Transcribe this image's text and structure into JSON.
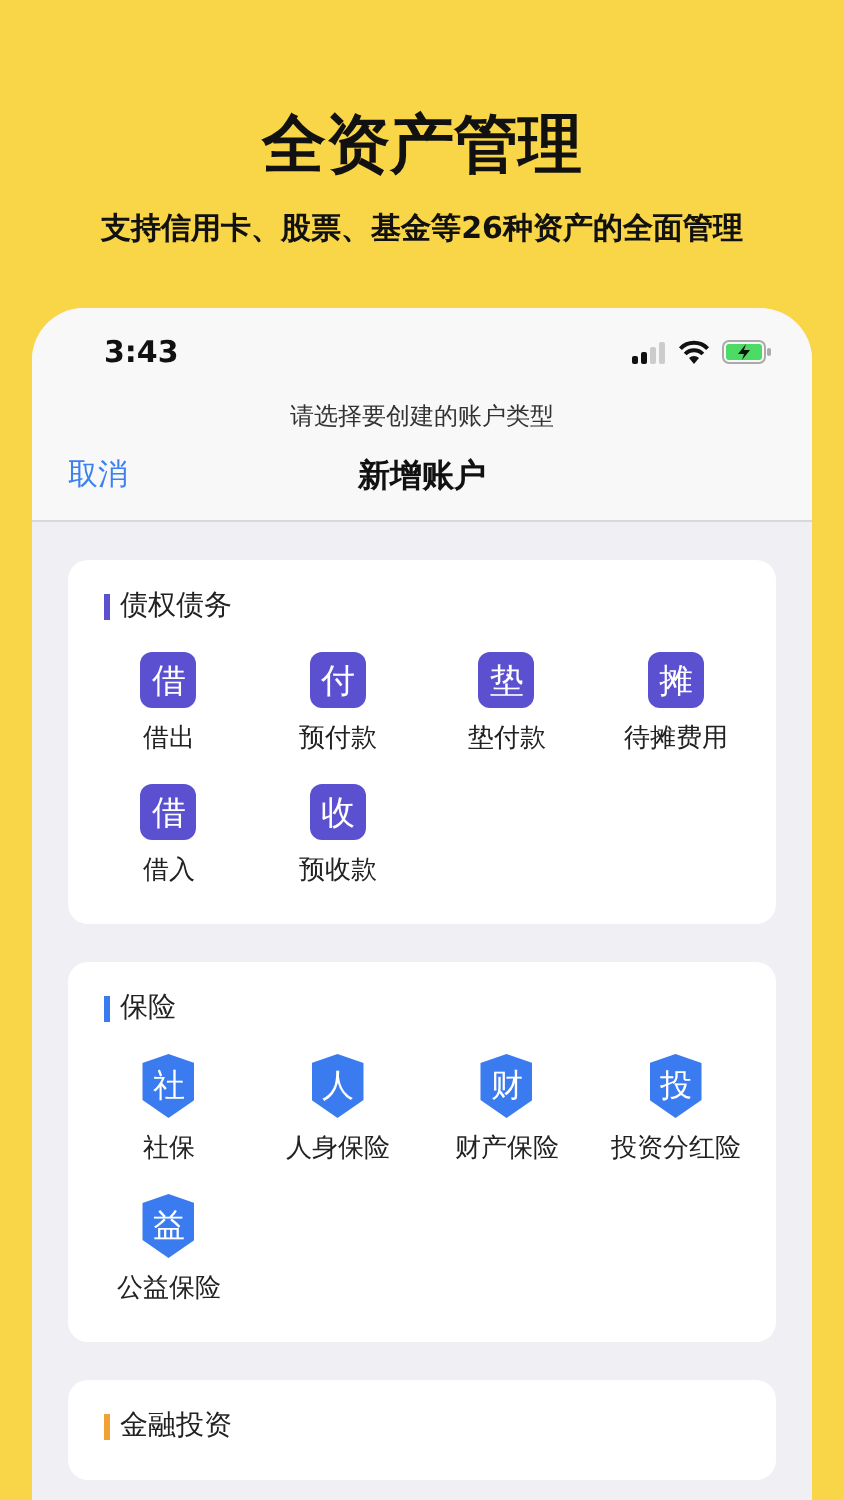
{
  "headline": "全资产管理",
  "subheadline": "支持信用卡、股票、基金等26种资产的全面管理",
  "status_bar": {
    "time": "3:43"
  },
  "prompt": "请选择要创建的账户类型",
  "nav": {
    "cancel": "取消",
    "title": "新增账户"
  },
  "sections": [
    {
      "title": "债权债务",
      "color": "#5b51d0",
      "items": [
        {
          "kind": "square",
          "icon_char": "借",
          "label": "借出"
        },
        {
          "kind": "square",
          "icon_char": "付",
          "label": "预付款"
        },
        {
          "kind": "square",
          "icon_char": "垫",
          "label": "垫付款"
        },
        {
          "kind": "square",
          "icon_char": "摊",
          "label": "待摊费用"
        },
        {
          "kind": "square",
          "icon_char": "借",
          "label": "借入"
        },
        {
          "kind": "square",
          "icon_char": "收",
          "label": "预收款"
        }
      ]
    },
    {
      "title": "保险",
      "color": "#3a7bef",
      "items": [
        {
          "kind": "shield",
          "icon_char": "社",
          "label": "社保"
        },
        {
          "kind": "shield",
          "icon_char": "人",
          "label": "人身保险"
        },
        {
          "kind": "shield",
          "icon_char": "财",
          "label": "财产保险"
        },
        {
          "kind": "shield",
          "icon_char": "投",
          "label": "投资分红险"
        },
        {
          "kind": "shield",
          "icon_char": "益",
          "label": "公益保险"
        }
      ]
    },
    {
      "title": "金融投资",
      "color": "#f0a236"
    }
  ]
}
